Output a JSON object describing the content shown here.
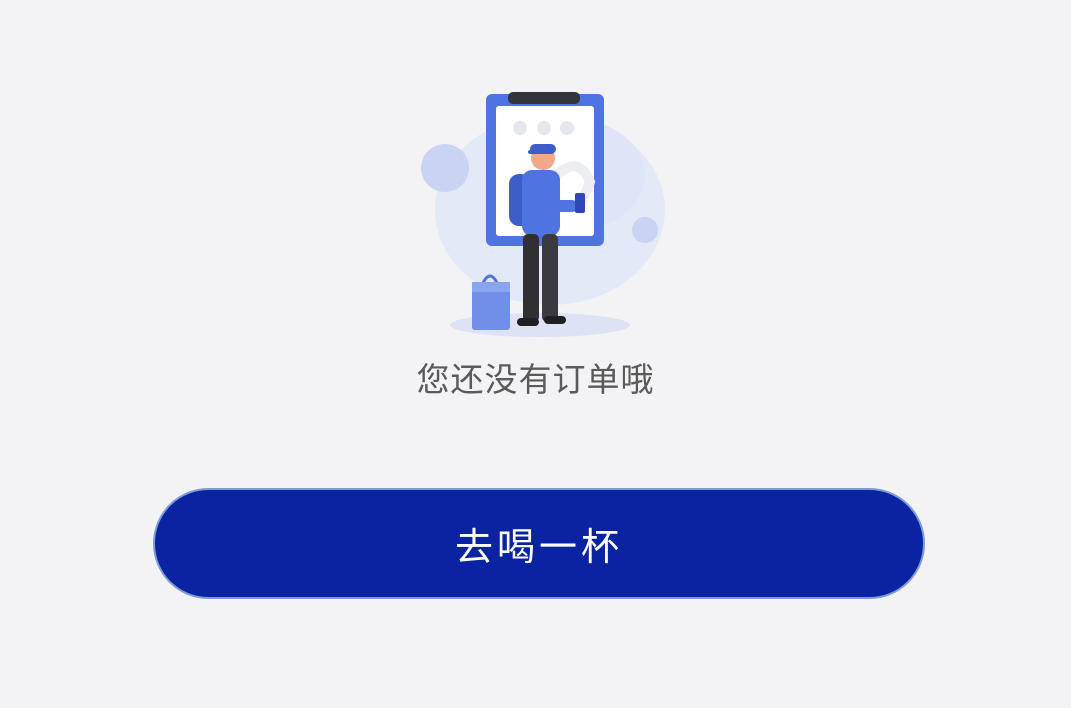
{
  "empty_state": {
    "illustration_icon": "empty-orders-illustration-icon",
    "message": "您还没有订单哦"
  },
  "cta": {
    "label": "去喝一杯"
  },
  "colors": {
    "background": "#f3f3f5",
    "button": "#0a24a1",
    "button_border": "#7c9bd6",
    "message_text": "#5a5a5a",
    "accent_blue": "#4f73e0"
  }
}
